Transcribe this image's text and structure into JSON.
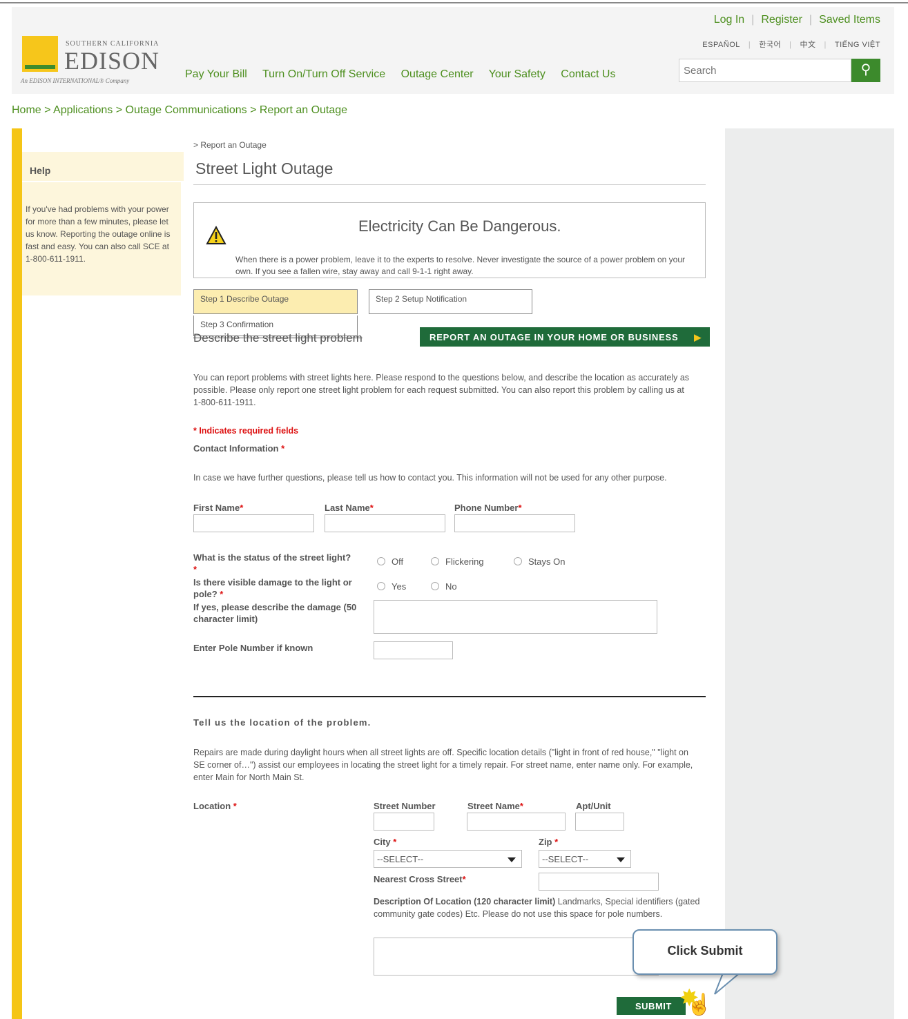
{
  "header": {
    "links": [
      "Log In",
      "Register",
      "Saved Items"
    ],
    "languages": [
      "ESPAÑOL",
      "한국어",
      "中文",
      "TIẾNG VIỆT"
    ],
    "logo": {
      "small": "SOUTHERN CALIFORNIA",
      "big": "EDISON",
      "tagline": "An EDISON INTERNATIONAL® Company"
    },
    "nav": [
      "Pay Your Bill",
      "Turn On/Turn Off Service",
      "Outage Center",
      "Your Safety",
      "Contact Us"
    ],
    "search_placeholder": "Search"
  },
  "breadcrumb": "Home > Applications > Outage Communications > Report an Outage",
  "help": {
    "title": "Help",
    "text": "If you've had problems with your power for more than a few minutes, please let us know. Reporting the outage online is fast and easy. You can also call SCE at 1-800-611-1911."
  },
  "page": {
    "subcrumb": "> Report an Outage",
    "title": "Street Light Outage",
    "warning_title": "Electricity Can Be Dangerous.",
    "warning_text": "When there is a power problem, leave it to the experts to resolve. Never investigate the source of a power problem on your own. If you see a fallen wire, stay away and call 9-1-1 right away.",
    "steps": [
      "Step 1 Describe Outage",
      "Step 2 Setup Notification",
      "Step 3 Confirmation"
    ],
    "describe_heading": "Describe the street light problem",
    "report_button": "REPORT AN OUTAGE IN YOUR HOME OR BUSINESS",
    "intro": "You can report problems with street lights here. Please respond to the questions below, and describe the location as accurately as possible. Please only report one street light problem for each request submitted. You can also report this problem by calling us at 1-800-611-1911.",
    "required_note": "* Indicates required fields",
    "contact_label": "Contact Information",
    "contact_note": "In case we have further questions, please tell us how to contact you. This information will not be used for any other purpose.",
    "first_name": "First Name",
    "last_name": "Last Name",
    "phone": "Phone Number",
    "status_q": "What is the status of the street light?",
    "status_opts": [
      "Off",
      "Flickering",
      "Stays On"
    ],
    "damage_q": "Is there visible damage to the light or pole?",
    "damage_opts": [
      "Yes",
      "No"
    ],
    "damage_desc": "If yes, please describe the damage (50 character limit)",
    "pole_label": "Enter Pole Number if known",
    "location_heading": "Tell us the location of the problem.",
    "location_intro": "Repairs are made during daylight hours when all street lights are off. Specific location details (\"light in front of red house,\" \"light on SE corner of…\") assist our employees in locating the street light for a timely repair. For street name, enter name only. For example, enter Main for North Main St.",
    "location_label": "Location",
    "street_number": "Street Number",
    "street_name": "Street Name",
    "apt": "Apt/Unit",
    "city": "City",
    "zip": "Zip",
    "select_value": "--SELECT--",
    "cross_street": "Nearest Cross Street",
    "desc_loc_bold": "Description Of Location (120 character limit)",
    "desc_loc_rest": " Landmarks, Special identifiers (gated community gate codes) Etc. Please do not use this space for pole numbers.",
    "submit": "SUBMIT"
  },
  "callout": "Click Submit",
  "colors": {
    "brand_green": "#4d8f1f",
    "button_green": "#1f6b3a",
    "accent_yellow": "#f5c516"
  }
}
